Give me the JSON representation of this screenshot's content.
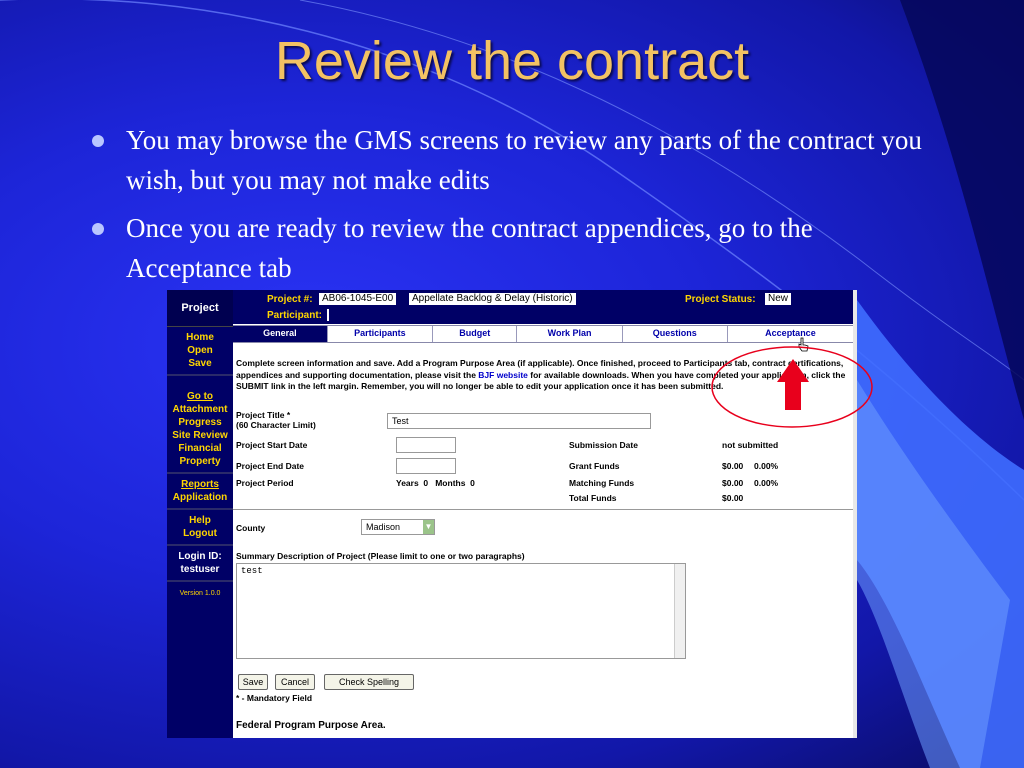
{
  "slide": {
    "title": "Review the contract",
    "bullets": [
      "You may browse the GMS screens to review any parts of the contract you wish, but you may not make edits",
      "Once you are ready to review the contract appendices, go to the Acceptance tab"
    ]
  },
  "app": {
    "sidebar": {
      "header": "Project",
      "group1": [
        "Home",
        "Open",
        "Save"
      ],
      "group2": [
        "Go to",
        "Attachment",
        "Progress",
        "Site Review",
        "Financial",
        "Property"
      ],
      "group3": [
        "Reports",
        "Application"
      ],
      "group4": [
        "Help",
        "Logout"
      ],
      "login_label": "Login ID:",
      "login_value": "testuser",
      "version": "Version 1.0.0"
    },
    "topbar": {
      "project_label": "Project #:",
      "project_number": "AB06-1045-E00",
      "project_name": "Appellate Backlog & Delay (Historic)",
      "status_label": "Project Status:",
      "status_value": "New",
      "participant_label": "Participant:"
    },
    "tabs": [
      "General",
      "Participants",
      "Budget",
      "Work Plan",
      "Questions",
      "Acceptance"
    ],
    "instructions": {
      "part1": "Complete screen information and save. Add a Program Purpose Area (if applicable). Once finished, proceed to Participants tab, contract certifications, appendices and supporting documentation, please visit the ",
      "link": "BJF website",
      "part2": " for available downloads. When you have completed your application, click the SUBMIT link in the left margin. Remember, you will no longer be able to edit your application once it has been submitted."
    },
    "form": {
      "title_label_1": "Project Title *",
      "title_label_2": "(60 Character Limit)",
      "title_value": "Test",
      "start_label": "Project Start Date",
      "end_label": "Project End Date",
      "period_label": "Project Period",
      "period_value": "Years  0   Months  0",
      "submission_label": "Submission Date",
      "submission_value": "not submitted",
      "grant_label": "Grant Funds",
      "grant_value": "$0.00",
      "grant_pct": "0.00%",
      "matching_label": "Matching Funds",
      "matching_value": "$0.00",
      "matching_pct": "0.00%",
      "total_label": "Total Funds",
      "total_value": "$0.00",
      "county_label": "County",
      "county_value": "Madison",
      "summary_label": "Summary Description of Project (Please limit to one or two paragraphs)",
      "summary_value": "test",
      "save_btn": "Save",
      "cancel_btn": "Cancel",
      "spell_btn": "Check Spelling",
      "mandatory_note": "* - Mandatory Field",
      "fppa_label": "Federal Program Purpose Area."
    }
  },
  "colors": {
    "title": "#f3c263",
    "bg": "#1d25d8",
    "nav": "#000066",
    "nav_link": "#ffd600",
    "arrow": "#e8001c"
  }
}
